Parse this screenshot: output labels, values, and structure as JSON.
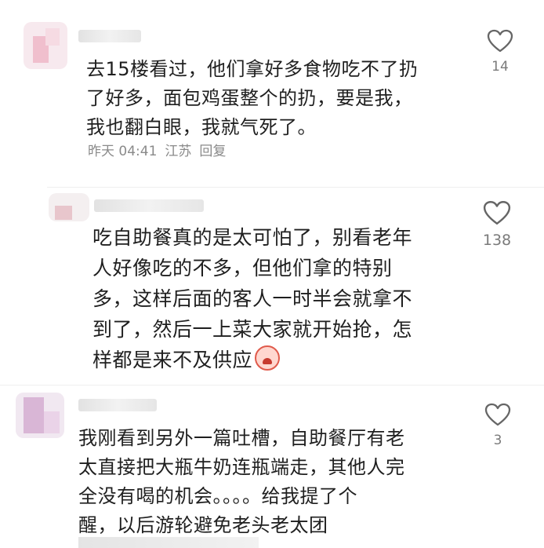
{
  "comments": [
    {
      "body": "去15楼看过，他们拿好多食物吃不了扔了好多，面包鸡蛋整个的扔，要是我，我也翻白眼，我就气死了。",
      "lines": [
        "去15楼看过，他们拿好多食物吃不了扔",
        "了好多，面包鸡蛋整个的扔，要是我，",
        "我也翻白眼，我就气死了。"
      ],
      "time": "昨天 04:41",
      "location": "江苏",
      "reply_label": "回复",
      "likes": "14"
    },
    {
      "lines": [
        "吃自助餐真的是太可怕了，别看老年",
        "人好像吃的不多，但他们拿的特别",
        "多，这样后面的客人一时半会就拿不",
        "到了，然后一上菜大家就开始抢，怎",
        "样都是来不及供应"
      ],
      "emoji": "crying-face-emoji",
      "likes": "138"
    },
    {
      "lines": [
        "我刚看到另外一篇吐槽，自助餐厅有老",
        "太直接把大瓶牛奶连瓶端走，其他人完",
        "全没有喝的机会。。。。给我提了个",
        "醒，以后游轮避免老头老太团"
      ],
      "likes": "3"
    }
  ],
  "colors": {
    "text": "#1f1f1f",
    "meta": "#8a8a8a",
    "heart": "#666666",
    "divider": "#efefef"
  },
  "icons": {
    "like": "heart-outline-icon"
  }
}
